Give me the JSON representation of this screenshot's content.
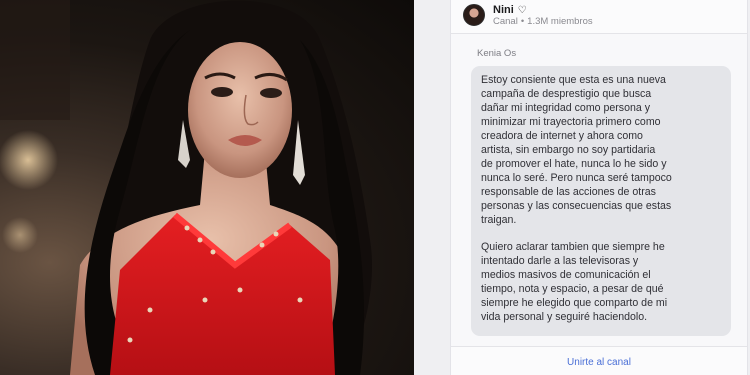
{
  "channel": {
    "name": "Nini",
    "name_suffix": "♡",
    "type": "Canal",
    "separator": "•",
    "members": "1.3M miembros"
  },
  "message": {
    "sender": "Kenia Os",
    "paragraphs": [
      "Estoy consiente que esta es una nueva\ncampaña de desprestigio que busca\ndañar mi integridad como persona y\nminimizar mi trayectoria primero como\ncreadora de internet y ahora como\nartista, sin embargo no soy partidaria\nde promover el hate, nunca lo he sido y\nnunca lo seré. Pero nunca seré tampoco\nresponsable de las acciones de otras\npersonas y las consecuencias que estas\ntraigan.",
      "Quiero aclarar tambien que siempre he\nintentado darle a las televisoras y\nmedios masivos de comunicación el\ntiempo, nota  y espacio, a pesar de qué\nsiempre he elegido que comparto de mi\nvida personal y seguiré haciendolo."
    ]
  },
  "footer": {
    "join_label": "Unirte al canal"
  },
  "colors": {
    "accent": "#4a6fd6",
    "dress": "#d8161d",
    "bubble": "#e4e5e9"
  }
}
